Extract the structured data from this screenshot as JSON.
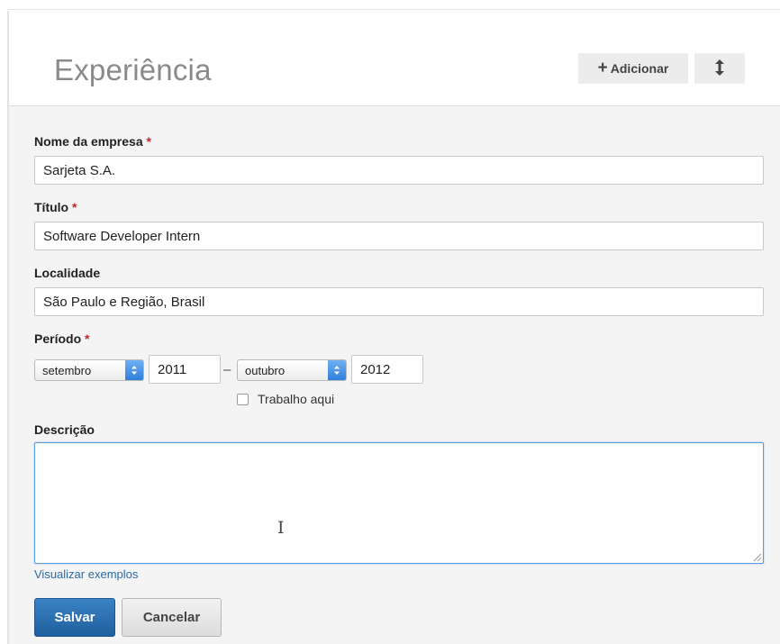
{
  "header": {
    "title": "Experiência",
    "add_button": {
      "icon": "plus-icon",
      "label": "Adicionar"
    },
    "sort_button": {
      "icon": "vertical-arrows-icon"
    }
  },
  "form": {
    "company": {
      "label": "Nome da empresa",
      "required_mark": "*",
      "value": "Sarjeta S.A."
    },
    "title": {
      "label": "Título",
      "required_mark": "*",
      "value": "Software Developer Intern"
    },
    "location": {
      "label": "Localidade",
      "value": "São Paulo e Região, Brasil"
    },
    "period": {
      "label": "Período",
      "required_mark": "*",
      "start_month": "setembro",
      "start_year": "2011",
      "separator": "–",
      "end_month": "outubro",
      "end_year": "2012",
      "current_label": "Trabalho aqui",
      "current_checked": false
    },
    "description": {
      "label": "Descrição",
      "value": ""
    },
    "examples_link": "Visualizar exemplos"
  },
  "actions": {
    "save": "Salvar",
    "cancel": "Cancelar"
  },
  "colors": {
    "primary": "#2a6db0",
    "required": "#c0272d",
    "link": "#2a6aa8",
    "select_accent": "#3a87e0"
  }
}
